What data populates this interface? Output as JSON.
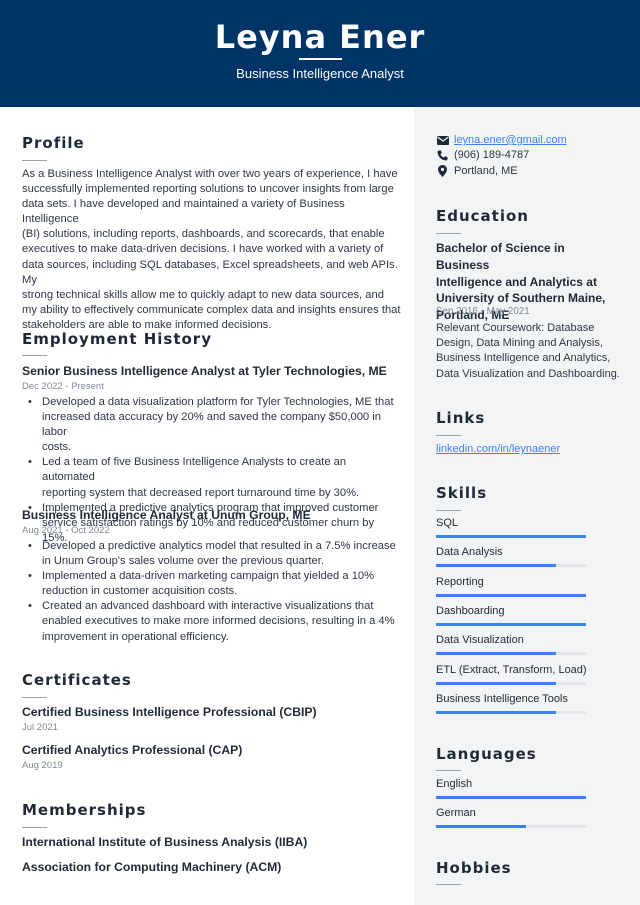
{
  "header": {
    "name": "Leyna Ener",
    "title": "Business Intelligence Analyst"
  },
  "profile": {
    "heading": "Profile",
    "lines": [
      "As a Business Intelligence Analyst with over two years of experience, I have",
      "successfully implemented reporting solutions to uncover insights from large",
      "data sets. I have developed and maintained a variety of Business Intelligence",
      "(BI) solutions, including reports, dashboards, and scorecards, that enable",
      "executives to make data-driven decisions. I have worked with a variety of",
      "data sources, including SQL databases, Excel spreadsheets, and web APIs. My",
      "strong technical skills allow me to quickly adapt to new data sources, and",
      "my ability to effectively communicate complex data and insights ensures that",
      "stakeholders are able to make informed decisions."
    ]
  },
  "employment": {
    "heading": "Employment History",
    "jobs": [
      {
        "title": "Senior Business Intelligence Analyst at Tyler Technologies, ME",
        "dates": "Dec 2022 - Present",
        "bullets": [
          [
            "Developed a data visualization platform for Tyler Technologies, ME that",
            "increased data accuracy by 20% and saved the company $50,000 in labor",
            "costs."
          ],
          [
            "Led a team of five Business Intelligence Analysts to create an automated",
            "reporting system that decreased report turnaround time by 30%."
          ],
          [
            "Implemented a predictive analytics program that improved customer",
            "service satisfaction ratings by 10% and reduced customer churn by 15%."
          ]
        ]
      },
      {
        "title": "Business Intelligence Analyst at Unum Group, ME",
        "dates": "Aug 2021 - Oct 2022",
        "bullets": [
          [
            "Developed a predictive analytics model that resulted in a 7.5% increase",
            "in Unum Group's sales volume over the previous quarter."
          ],
          [
            "Implemented a data-driven marketing campaign that yielded a 10%",
            "reduction in customer acquisition costs."
          ],
          [
            "Created an advanced dashboard with interactive visualizations that",
            "enabled executives to make more informed decisions, resulting in a 4%",
            "improvement in operational efficiency."
          ]
        ]
      }
    ]
  },
  "certificates": {
    "heading": "Certificates",
    "items": [
      {
        "name": "Certified Business Intelligence Professional (CBIP)",
        "date": "Jul 2021"
      },
      {
        "name": "Certified Analytics Professional (CAP)",
        "date": "Aug 2019"
      }
    ]
  },
  "memberships": {
    "heading": "Memberships",
    "items": [
      "International Institute of Business Analysis (IIBA)",
      "Association for Computing Machinery (ACM)"
    ]
  },
  "contact": {
    "email": "leyna.ener@gmail.com",
    "phone": "(906) 189-4787",
    "location": "Portland, ME",
    "icons": {
      "email": "envelope-icon",
      "phone": "phone-icon",
      "location": "map-pin-icon"
    }
  },
  "education": {
    "heading": "Education",
    "degree_lines": [
      "Bachelor of Science in Business",
      "Intelligence and Analytics at",
      "University of Southern Maine,",
      "Portland, ME"
    ],
    "dates": "Sep 2016 - May 2021",
    "desc_lines": [
      "Relevant Coursework: Database",
      "Design, Data Mining and Analysis,",
      "Business Intelligence and Analytics,",
      "Data Visualization and Dashboarding."
    ]
  },
  "links": {
    "heading": "Links",
    "items": [
      "linkedin.com/in/leynaener"
    ]
  },
  "skills": {
    "heading": "Skills",
    "items": [
      {
        "name": "SQL",
        "level": 1.0
      },
      {
        "name": "Data Analysis",
        "level": 0.8
      },
      {
        "name": "Reporting",
        "level": 1.0
      },
      {
        "name": "Dashboarding",
        "level": 1.0
      },
      {
        "name": "Data Visualization",
        "level": 0.8
      },
      {
        "name": "ETL (Extract, Transform, Load)",
        "level": 0.8
      },
      {
        "name": "Business Intelligence Tools",
        "level": 0.8
      }
    ]
  },
  "languages": {
    "heading": "Languages",
    "items": [
      {
        "name": "English",
        "level": 1.0
      },
      {
        "name": "German",
        "level": 0.6
      }
    ]
  },
  "hobbies": {
    "heading": "Hobbies"
  },
  "colors": {
    "header_bg": "#003366",
    "accent": "#3b82f6",
    "sidebar_bg": "#f3f4f6"
  }
}
